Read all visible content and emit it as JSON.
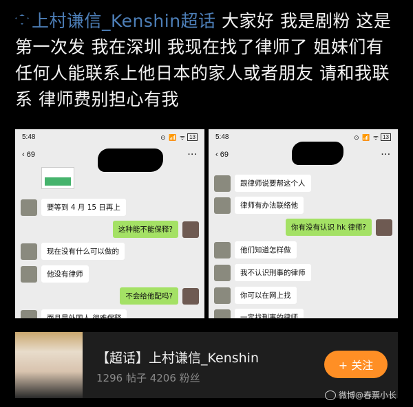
{
  "post": {
    "topic": "上村谦信_Kenshin超话",
    "text": " 大家好 我是剧粉 这是第一次发 我在深圳 我现在找了律师了 姐妹们有任何人能联系上他日本的家人或者朋友 请和我联系 律师费别担心有我"
  },
  "screenshot_left": {
    "time": "5:48",
    "status_icons": "⊙ 📶 ᯤ",
    "battery": "13",
    "back_count": "69",
    "messages": [
      {
        "side": "in",
        "text": "要等到 4 月 15 日再上"
      },
      {
        "side": "out",
        "text": "这种能不能保释?"
      },
      {
        "side": "in",
        "text": "现在没有什么可以做的"
      },
      {
        "side": "in",
        "text": "他没有律师"
      },
      {
        "side": "out",
        "text": "不会给他配吗?"
      },
      {
        "side": "in",
        "text": "而且是外国人 很难保释"
      }
    ]
  },
  "screenshot_right": {
    "time": "5:48",
    "status_icons": "⊙ 📶 ᯤ",
    "battery": "13",
    "back_count": "69",
    "messages": [
      {
        "side": "in",
        "text": "跟律师说要帮这个人"
      },
      {
        "side": "in",
        "text": "律师有办法联络他"
      },
      {
        "side": "out",
        "text": "你有没有认识 hk 律师?"
      },
      {
        "side": "in",
        "text": "他们知道怎样做"
      },
      {
        "side": "in",
        "text": "我不认识刑事的律师"
      },
      {
        "side": "in",
        "text": "你可以在网上找"
      },
      {
        "side": "in",
        "text": "一定找刑事的律师"
      }
    ]
  },
  "topic_card": {
    "name": "【超话】上村谦信_Kenshin",
    "stats": "1296 帖子 4206 粉丝",
    "follow_label": "+ 关注"
  },
  "watermark": "微博@春票小长"
}
